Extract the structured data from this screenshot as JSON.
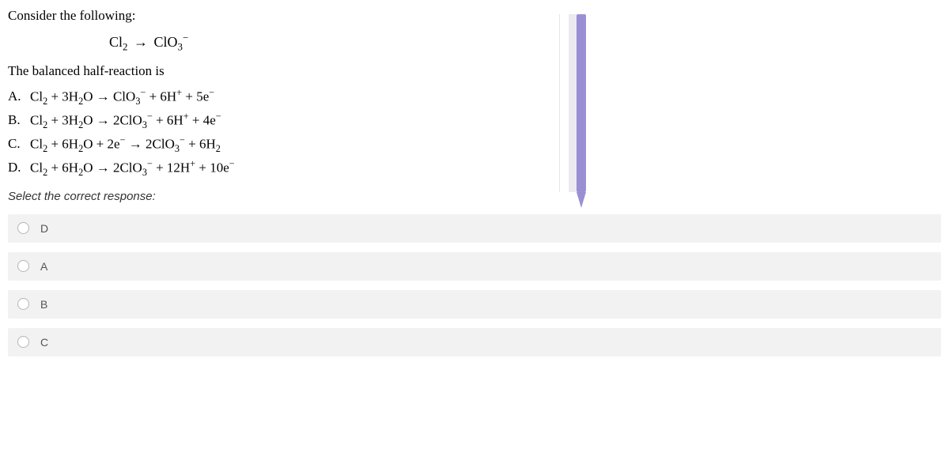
{
  "question": {
    "intro": "Consider the following:",
    "main_equation_html": "Cl<span class=\"sub\">2</span> <span class=\"arrow\">→</span> ClO<span class=\"sub\">3</span><span class=\"sup\">−</span>",
    "lead": "The balanced half-reaction is",
    "choices": [
      {
        "letter": "A.",
        "eqn_html": "Cl<span class=\"sub\">2</span> + 3H<span class=\"sub\">2</span>O → ClO<span class=\"sub\">3</span><span class=\"sup\">−</span> + 6H<span class=\"sup\">+</span> + 5e<span class=\"sup\">−</span>"
      },
      {
        "letter": "B.",
        "eqn_html": "Cl<span class=\"sub\">2</span> + 3H<span class=\"sub\">2</span>O → 2ClO<span class=\"sub\">3</span><span class=\"sup\">−</span> + 6H<span class=\"sup\">+</span> + 4e<span class=\"sup\">−</span>"
      },
      {
        "letter": "C.",
        "eqn_html": "Cl<span class=\"sub\">2</span> + 6H<span class=\"sub\">2</span>O + 2e<span class=\"sup\">−</span> → 2ClO<span class=\"sub\">3</span><span class=\"sup\">−</span> + 6H<span class=\"sub\">2</span>"
      },
      {
        "letter": "D.",
        "eqn_html": "Cl<span class=\"sub\">2</span> + 6H<span class=\"sub\">2</span>O → 2ClO<span class=\"sub\">3</span><span class=\"sup\">−</span> + 12H<span class=\"sup\">+</span> + 10e<span class=\"sup\">−</span>"
      }
    ],
    "select_prompt": "Select the correct response:"
  },
  "options": [
    {
      "label": "D"
    },
    {
      "label": "A"
    },
    {
      "label": "B"
    },
    {
      "label": "C"
    }
  ]
}
